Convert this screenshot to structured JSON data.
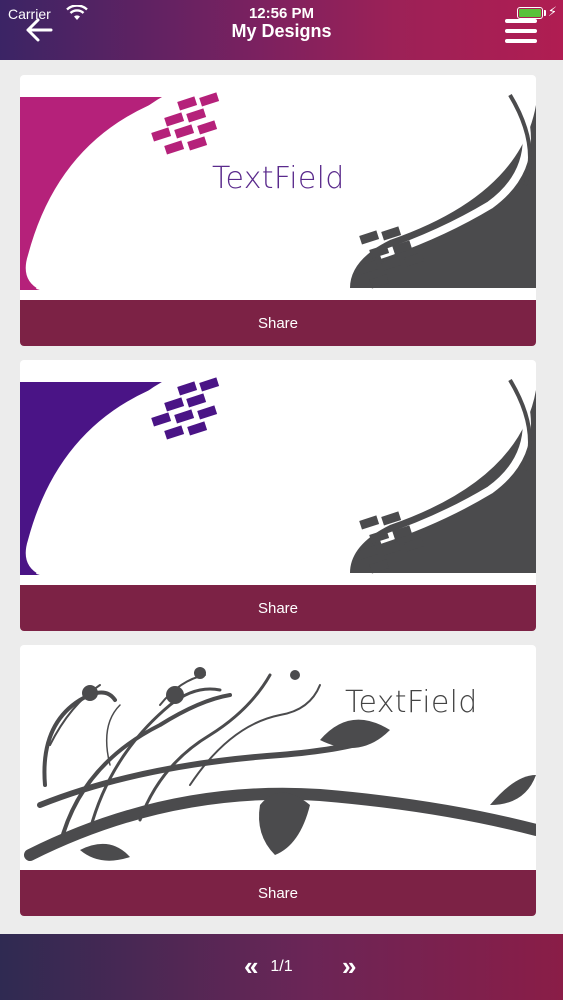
{
  "status_bar": {
    "carrier": "Carrier",
    "time": "12:56 PM"
  },
  "header": {
    "title": "My Designs",
    "back_icon": "arrow-left-icon",
    "menu_icon": "hamburger-menu-icon"
  },
  "designs": [
    {
      "text": "TextField",
      "share_label": "Share",
      "accent_color": "#b5217a",
      "dark_color": "#4b4b4d"
    },
    {
      "text": "",
      "share_label": "Share",
      "accent_color": "#4a1486",
      "dark_color": "#4b4b4d"
    },
    {
      "text": "TextField",
      "share_label": "Share",
      "accent_color": "#4b4b4d"
    }
  ],
  "pagination": {
    "prev_icon": "«",
    "next_icon": "»",
    "label": "1/1"
  },
  "colors": {
    "header_gradient_start": "#3b2465",
    "header_gradient_end": "#b01d52",
    "share_button": "#7c2245",
    "background": "#ececec"
  }
}
